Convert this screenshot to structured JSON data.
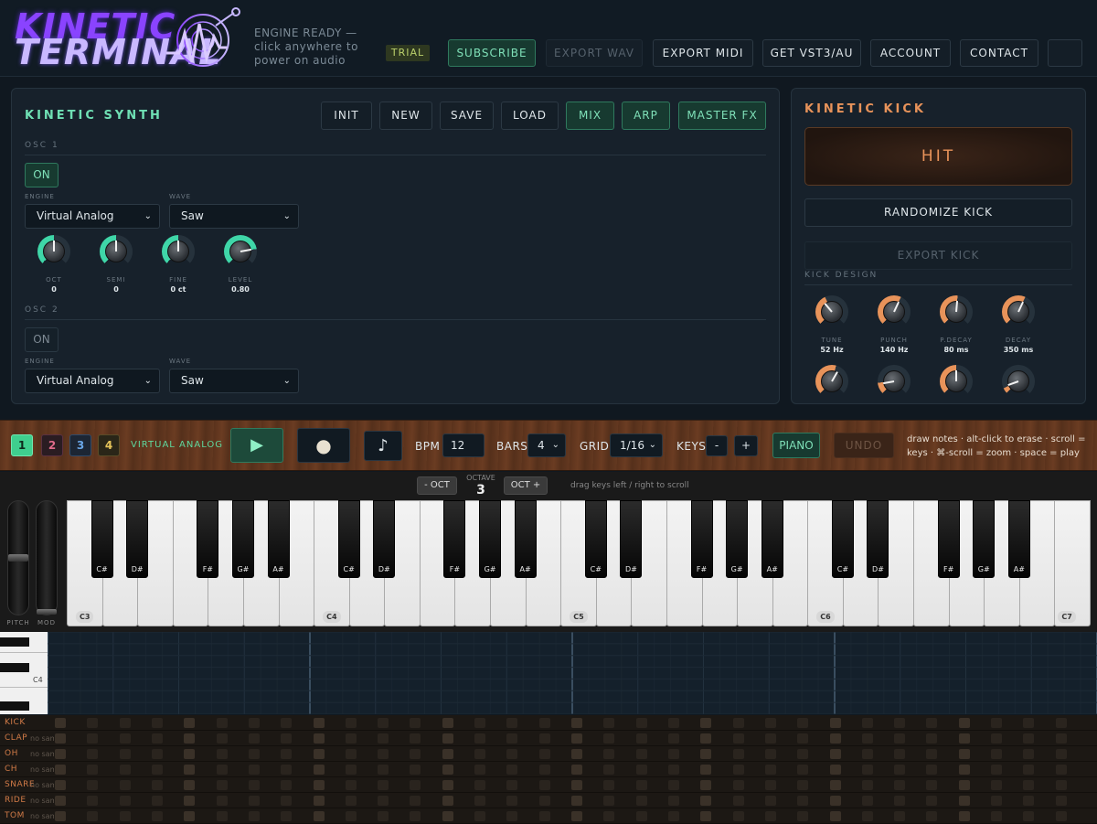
{
  "header": {
    "logo_line1": "KINETIC",
    "logo_line2": "TERMINAL",
    "status_text": "ENGINE READY — click anywhere to power on audio",
    "trial_badge": "TRIAL",
    "buttons": {
      "subscribe": "SUBSCRIBE",
      "export_wav": "EXPORT WAV",
      "export_midi": "EXPORT MIDI",
      "get_vst": "GET VST3/AU",
      "account": "ACCOUNT",
      "contact": "CONTACT"
    }
  },
  "synth": {
    "title": "KINETIC SYNTH",
    "buttons": {
      "init": "INIT",
      "new": "NEW",
      "save": "SAVE",
      "load": "LOAD",
      "mix": "MIX",
      "arp": "ARP",
      "master_fx": "MASTER FX"
    },
    "osc1": {
      "label": "OSC 1",
      "on_label": "ON",
      "engine_label": "ENGINE",
      "engine_value": "Virtual Analog",
      "wave_label": "WAVE",
      "wave_value": "Saw",
      "knobs": [
        {
          "label": "OCT",
          "value": "0"
        },
        {
          "label": "SEMI",
          "value": "0"
        },
        {
          "label": "FINE",
          "value": "0 ct"
        },
        {
          "label": "LEVEL",
          "value": "0.80"
        }
      ]
    },
    "osc2": {
      "label": "OSC 2",
      "on_label": "ON",
      "engine_label": "ENGINE",
      "engine_value": "Virtual Analog",
      "wave_label": "WAVE",
      "wave_value": "Saw"
    }
  },
  "kick": {
    "title": "KINETIC KICK",
    "hit_label": "HIT",
    "randomize_label": "RANDOMIZE KICK",
    "export_label": "EXPORT KICK",
    "design_label": "KICK DESIGN",
    "knobs": [
      {
        "label": "TUNE",
        "value": "52 Hz"
      },
      {
        "label": "PUNCH",
        "value": "140 Hz"
      },
      {
        "label": "P.DECAY",
        "value": "80 ms"
      },
      {
        "label": "DECAY",
        "value": "350 ms"
      }
    ]
  },
  "transport": {
    "tracks": [
      "1",
      "2",
      "3",
      "4"
    ],
    "engine_name": "VIRTUAL ANALOG",
    "play_icon": "▶",
    "record_icon": "●",
    "metronome_icon": "♪",
    "bpm_label": "BPM",
    "bpm_value": "12",
    "bars_label": "BARS",
    "bars_value": "4",
    "grid_label": "GRID",
    "grid_value": "1/16",
    "keys_label": "KEYS",
    "keys_minus": "-",
    "keys_plus": "+",
    "piano_label": "PIANO",
    "undo_label": "UNDO",
    "help_line1": "draw notes · alt-click to erase · scroll =",
    "help_line2": "keys · ⌘-scroll = zoom · space = play"
  },
  "octave": {
    "down_label": "- OCT",
    "title": "OCTAVE",
    "value": "3",
    "up_label": "OCT +",
    "hint": "drag keys left / right to scroll"
  },
  "wheels": {
    "pitch_label": "PITCH",
    "mod_label": "MOD"
  },
  "keyboard": {
    "c_labels": [
      "C3",
      "C4",
      "C5",
      "C6",
      "C7"
    ],
    "black_labels": [
      "C#",
      "D#",
      "F#",
      "G#",
      "A#"
    ]
  },
  "roll": {
    "key_label": "C4"
  },
  "drums": {
    "rows": [
      {
        "name": "KICK",
        "sub": ""
      },
      {
        "name": "CLAP",
        "sub": "no sam"
      },
      {
        "name": "OH",
        "sub": "no sam"
      },
      {
        "name": "CH",
        "sub": "no sam"
      },
      {
        "name": "SNARE",
        "sub": "no sam"
      },
      {
        "name": "RIDE",
        "sub": "no sam"
      },
      {
        "name": "TOM",
        "sub": "no sam"
      }
    ]
  },
  "colors": {
    "accent_green": "#7fe0b8",
    "accent_orange": "#e8935a",
    "logo_purple": "#8a43ff"
  }
}
